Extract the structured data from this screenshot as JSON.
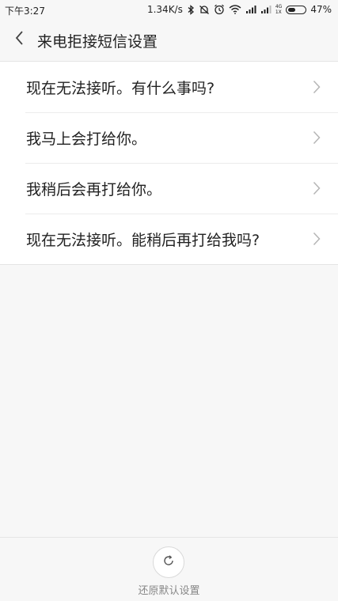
{
  "status_bar": {
    "time": "下午3:27",
    "speed": "1.34K/s",
    "network_small_top": "4G",
    "network_small_bottom": "1X",
    "battery_text": "47%",
    "battery_level": 0.47,
    "icons": [
      "bluetooth-icon",
      "mute-icon",
      "alarm-icon",
      "wifi-icon",
      "signal-icon",
      "signal-icon",
      "battery-icon"
    ]
  },
  "header": {
    "title": "来电拒接短信设置",
    "back_icon": "chevron-left-icon"
  },
  "list": {
    "items": [
      {
        "label": "现在无法接听。有什么事吗?"
      },
      {
        "label": "我马上会打给你。"
      },
      {
        "label": "我稍后会再打给你。"
      },
      {
        "label": "现在无法接听。能稍后再打给我吗?"
      }
    ],
    "chevron_icon": "chevron-right-icon"
  },
  "bottom": {
    "reset_label": "还原默认设置",
    "reset_icon": "refresh-icon"
  }
}
